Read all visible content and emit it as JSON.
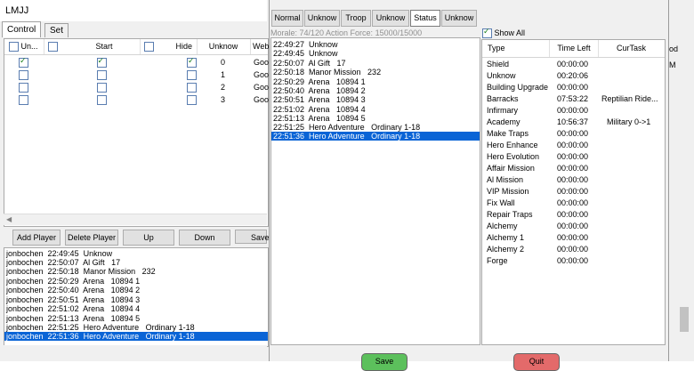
{
  "bg_window": {
    "title": "LMJJ",
    "tabs": [
      "Control",
      "Set"
    ],
    "grid_headers": {
      "col1": "Un...",
      "col2": "Start",
      "col3": "Hide",
      "col4": "Unknow",
      "col5": "Web"
    },
    "grid_rows": [
      {
        "unknow": "0",
        "web": "Goo",
        "c1": true,
        "c2": true,
        "c3": true
      },
      {
        "unknow": "1",
        "web": "Goo",
        "c1": false,
        "c2": false,
        "c3": false
      },
      {
        "unknow": "2",
        "web": "Goo",
        "c1": false,
        "c2": false,
        "c3": false
      },
      {
        "unknow": "3",
        "web": "Goo",
        "c1": false,
        "c2": false,
        "c3": false
      }
    ],
    "buttons": {
      "add_player": "Add Player",
      "delete_player": "Delete Player",
      "up": "Up",
      "down": "Down",
      "save": "Save"
    },
    "log": [
      "jonbochen  22:49:45  Unknow",
      "jonbochen  22:50:07  Al Gift   17",
      "jonbochen  22:50:18  Manor Mission   232",
      "jonbochen  22:50:29  Arena   10894 1",
      "jonbochen  22:50:40  Arena   10894 2",
      "jonbochen  22:50:51  Arena   10894 3",
      "jonbochen  22:51:02  Arena   10894 4",
      "jonbochen  22:51:13  Arena   10894 5",
      "jonbochen  22:51:25  Hero Adventure   Ordinary 1-18",
      "jonbochen  22:51:36  Hero Adventure   Ordinary 1-18"
    ],
    "right_texts": [
      "od",
      "M"
    ]
  },
  "dialog": {
    "top_buttons": [
      "Normal",
      "Unknow",
      "Troop",
      "Unknow",
      "Status",
      "Unknow"
    ],
    "active_button": "Status",
    "morale_text": "Morale: 74/120   Action Force: 15000/15000",
    "log": [
      "22:49:27  Unknow",
      "22:49:45  Unknow",
      "22:50:07  Al Gift   17",
      "22:50:18  Manor Mission   232",
      "22:50:29  Arena   10894 1",
      "22:50:40  Arena   10894 2",
      "22:50:51  Arena   10894 3",
      "22:51:02  Arena   10894 4",
      "22:51:13  Arena   10894 5",
      "22:51:25  Hero Adventure   Ordinary 1-18",
      "22:51:36  Hero Adventure   Ordinary 1-18"
    ],
    "show_all_label": "Show All",
    "table_headers": {
      "type": "Type",
      "time_left": "Time Left",
      "cur_task": "CurTask"
    },
    "table_rows": [
      {
        "type": "Shield",
        "time": "00:00:00",
        "task": ""
      },
      {
        "type": "Unknow",
        "time": "00:20:06",
        "task": ""
      },
      {
        "type": "Building Upgrade",
        "time": "00:00:00",
        "task": ""
      },
      {
        "type": "Barracks",
        "time": "07:53:22",
        "task": "Reptilian Ride..."
      },
      {
        "type": "Infirmary",
        "time": "00:00:00",
        "task": ""
      },
      {
        "type": "Academy",
        "time": "10:56:37",
        "task": "Military 0->1"
      },
      {
        "type": "Make Traps",
        "time": "00:00:00",
        "task": ""
      },
      {
        "type": "Hero Enhance",
        "time": "00:00:00",
        "task": ""
      },
      {
        "type": "Hero Evolution",
        "time": "00:00:00",
        "task": ""
      },
      {
        "type": "Affair Mission",
        "time": "00:00:00",
        "task": ""
      },
      {
        "type": "Al Mission",
        "time": "00:00:00",
        "task": ""
      },
      {
        "type": "VIP Mission",
        "time": "00:00:00",
        "task": ""
      },
      {
        "type": "Fix Wall",
        "time": "00:00:00",
        "task": ""
      },
      {
        "type": "Repair Traps",
        "time": "00:00:00",
        "task": ""
      },
      {
        "type": "Alchemy",
        "time": "00:00:00",
        "task": ""
      },
      {
        "type": "Alchemy 1",
        "time": "00:00:00",
        "task": ""
      },
      {
        "type": "Alchemy 2",
        "time": "00:00:00",
        "task": ""
      },
      {
        "type": "Forge",
        "time": "00:00:00",
        "task": ""
      }
    ],
    "save_label": "Save",
    "quit_label": "Quit"
  },
  "colors": {
    "selection": "#0a64d6",
    "save": "#5cc05c",
    "quit": "#e36a6a"
  }
}
